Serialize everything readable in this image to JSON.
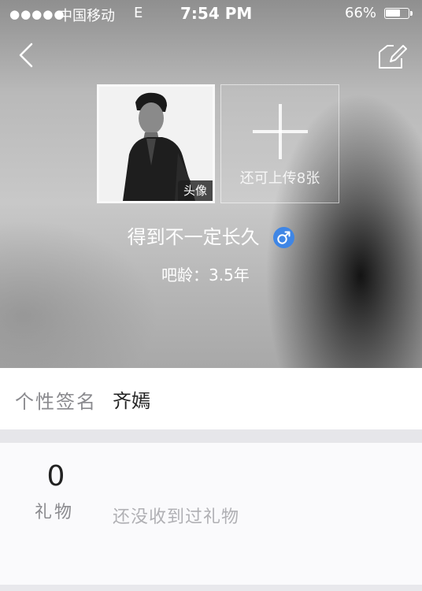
{
  "status_bar": {
    "signal": "●●●●●",
    "carrier": "中国移动",
    "network": "E",
    "time": "7:54 PM",
    "battery_percent": "66%",
    "battery_level": 0.66
  },
  "nav": {
    "back_icon": "chevron-left-icon",
    "edit_icon": "edit-icon"
  },
  "profile": {
    "avatar_tag": "头像",
    "upload_hint": "还可上传8张",
    "name": "得到不一定长久",
    "gender_icon": "male-icon",
    "gender_color": "#3f86e5",
    "bar_age": "吧龄：3.5年"
  },
  "signature": {
    "label": "个性签名",
    "value": "齐嫣"
  },
  "gifts": {
    "count": "0",
    "label": "礼物",
    "empty_text": "还没收到过礼物"
  }
}
